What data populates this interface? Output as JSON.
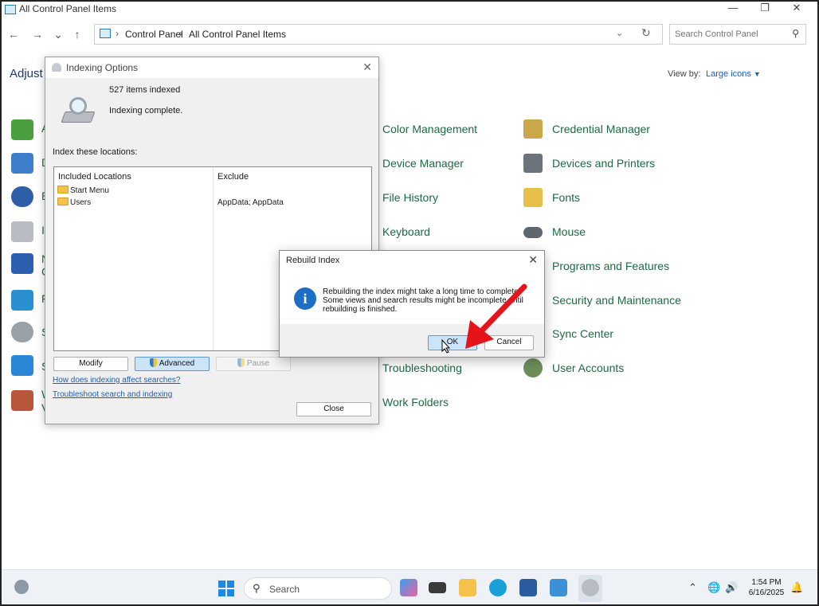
{
  "window": {
    "title": "All Control Panel Items",
    "minimize_glyph": "—",
    "restore_glyph": "❐",
    "close_glyph": "✕"
  },
  "navigation": {
    "back_glyph": "←",
    "forward_glyph": "→",
    "recent_glyph": "⌄",
    "up_glyph": "↑",
    "breadcrumbs": [
      "Control Panel",
      "All Control Panel Items"
    ],
    "separator": "›",
    "search_placeholder": "Search Control Panel"
  },
  "main": {
    "heading_partial": "Adjust y",
    "view_by_label": "View by:",
    "view_by_value": "Large icons",
    "left_column_letters": [
      "A",
      "D",
      "E",
      "I",
      "N",
      "F",
      "S",
      "S",
      "W"
    ],
    "left_column_second_letters": [
      "C",
      "V"
    ],
    "items": [
      {
        "label": "Color Management",
        "icon": "color-management-icon"
      },
      {
        "label": "Credential Manager",
        "icon": "credential-manager-icon"
      },
      {
        "label": "Device Manager",
        "icon": "device-manager-icon"
      },
      {
        "label": "Devices and Printers",
        "icon": "printer-icon"
      },
      {
        "label": "File History",
        "icon": "file-history-icon"
      },
      {
        "label": "Fonts",
        "icon": "fonts-icon"
      },
      {
        "label": "Keyboard",
        "icon": "keyboard-icon"
      },
      {
        "label": "Mouse",
        "icon": "mouse-icon"
      },
      {
        "label": "Programs and Features",
        "icon": "programs-icon"
      },
      {
        "label": "Security and Maintenance",
        "icon": "security-flag-icon"
      },
      {
        "label": "Sync Center",
        "icon": "sync-center-icon"
      },
      {
        "label": "Troubleshooting",
        "icon": "troubleshooting-icon"
      },
      {
        "label": "User Accounts",
        "icon": "user-accounts-icon"
      },
      {
        "label": "Work Folders",
        "icon": "work-folders-icon"
      }
    ]
  },
  "indexing_dialog": {
    "title": "Indexing Options",
    "close_glyph": "✕",
    "items_indexed": "527 items indexed",
    "status": "Indexing complete.",
    "index_locations_label": "Index these locations:",
    "columns": {
      "included": "Included Locations",
      "exclude": "Exclude"
    },
    "locations": [
      {
        "name": "Start Menu",
        "exclude": ""
      },
      {
        "name": "Users",
        "exclude": "AppData; AppData"
      }
    ],
    "buttons": {
      "modify": "Modify",
      "advanced": "Advanced",
      "pause": "Pause",
      "close": "Close"
    },
    "links": {
      "how_indexing": "How does indexing affect searches?",
      "troubleshoot": "Troubleshoot search and indexing"
    }
  },
  "rebuild_dialog": {
    "title": "Rebuild Index",
    "close_glyph": "✕",
    "message_line1": "Rebuilding the index might take a long time to complete.",
    "message_line2": "Some views and search results might be incomplete until",
    "message_line3": "rebuilding is finished.",
    "ok_label": "OK",
    "cancel_label": "Cancel",
    "info_glyph": "i"
  },
  "taskbar": {
    "search_label": "Search",
    "time": "1:54 PM",
    "date": "6/16/2025",
    "tray_up_glyph": "⌃"
  },
  "colors": {
    "link_green": "#1d6a43",
    "accent_blue": "#1a5fb4",
    "arrow_red": "#e5141b"
  }
}
